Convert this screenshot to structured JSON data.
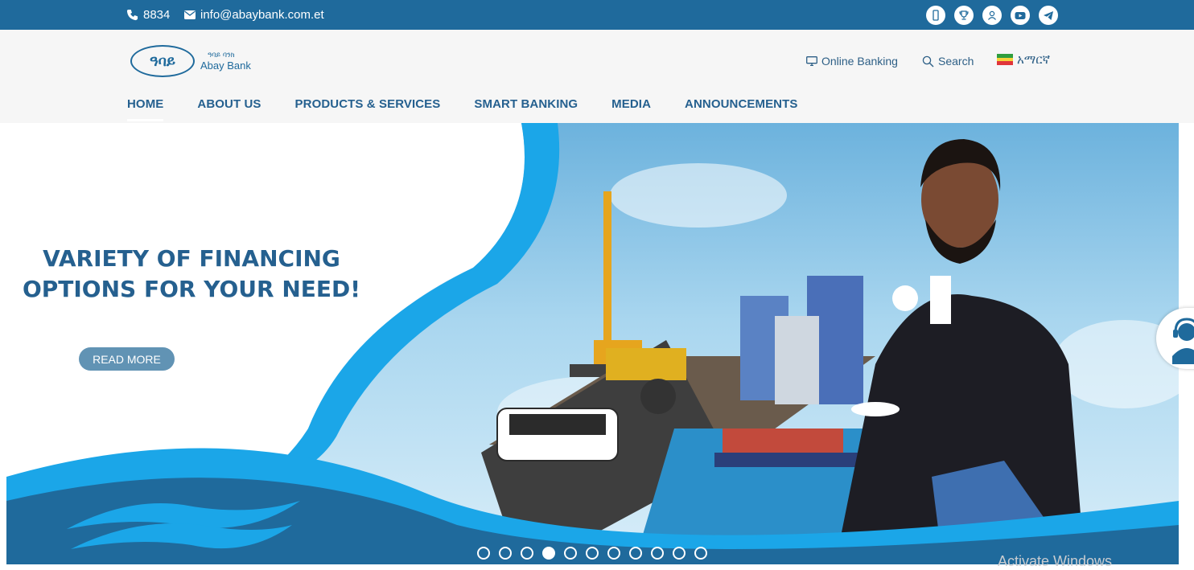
{
  "topbar": {
    "phone": "8834",
    "email": "info@abaybank.com.et",
    "social_icons": [
      "mobile-app-icon",
      "trophy-icon",
      "user-icon",
      "youtube-icon",
      "telegram-icon"
    ]
  },
  "header": {
    "logo_amharic": "ዓባይ ባንክ",
    "logo_english": "Abay Bank",
    "online_banking": "Online Banking",
    "search": "Search",
    "language": "አማርኛ"
  },
  "nav": {
    "items": [
      "HOME",
      "ABOUT US",
      "PRODUCTS & SERVICES",
      "SMART BANKING",
      "MEDIA",
      "ANNOUNCEMENTS"
    ],
    "active": "HOME"
  },
  "hero": {
    "headline_line1": "VARIETY OF FINANCING",
    "headline_line2": "OPTIONS FOR YOUR NEED!",
    "cta": "READ MORE",
    "slide_count": 11,
    "active_slide": 4
  },
  "watermark": "Activate Windows",
  "colors": {
    "brand_blue": "#1f6a9c",
    "nav_text": "#25608f",
    "accent_cyan": "#1ba6e8",
    "cta_bg": "#6193b4"
  }
}
